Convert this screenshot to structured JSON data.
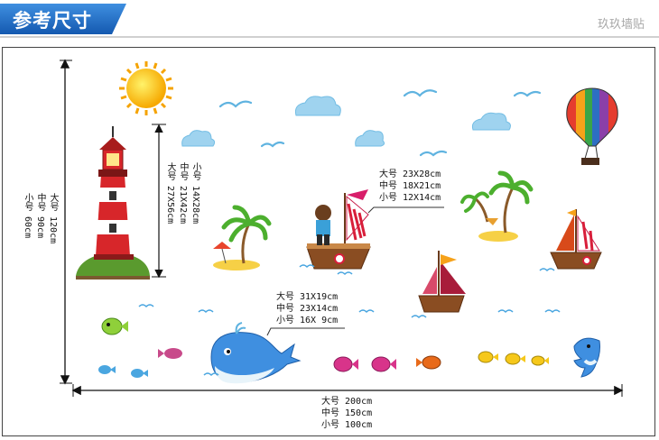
{
  "header": {
    "title": "参考尺寸",
    "brand": "玖玖墙贴",
    "accent_color": "#1e6fc8"
  },
  "dimensions": {
    "height_total": {
      "large": "大号 120cm",
      "medium": "中号 90cm",
      "small": "小号 60cm"
    },
    "width_total": {
      "large": "大号 200cm",
      "medium": "中号 150cm",
      "small": "小号 100cm"
    },
    "lighthouse": {
      "large": "大号 27X56cm",
      "medium": "中号 21X42cm",
      "small": "小号 14X28cm"
    },
    "boat": {
      "large": "大号 23X28cm",
      "medium": "中号 18X21cm",
      "small": "小号 12X14cm"
    },
    "whale": {
      "large": "大号 31X19cm",
      "medium": "中号 23X14cm",
      "small": "小号 16X 9cm"
    }
  },
  "illustration": {
    "icons": [
      "sun-icon",
      "seagull-icon",
      "cloud-icon",
      "hot-air-balloon-icon",
      "lighthouse-icon",
      "palm-island-icon",
      "sailboat-icon",
      "whale-icon",
      "fish-icon",
      "dolphin-icon",
      "wave-icon"
    ]
  }
}
